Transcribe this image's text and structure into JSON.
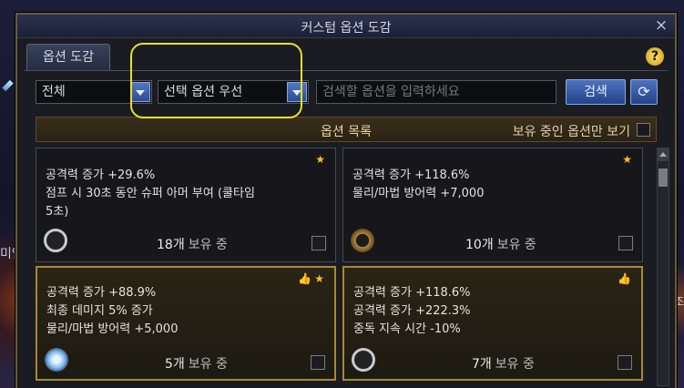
{
  "window": {
    "title": "커스텀 옵션 도감",
    "close": "×"
  },
  "tab": {
    "label": "옵션 도감"
  },
  "help": {
    "label": "?"
  },
  "filters": {
    "category": "전체",
    "order": "선택 옵션 우선",
    "search_placeholder": "검색할 옵션을 입력하세요",
    "search_button": "검색",
    "refresh_icon": "⟳"
  },
  "list": {
    "title": "옵션 목록",
    "owned_only_label": "보유 중인 옵션만 보기"
  },
  "owned_suffix": "보유 중",
  "background": {
    "left_text": "미엄",
    "right_text": "조"
  },
  "cards": [
    {
      "lines": [
        "공격력 증가 +29.6%",
        "점프 시 30초 동안 슈퍼 아머 부여 (쿨타임",
        "5초)"
      ],
      "icons": "★",
      "count": "18개",
      "highlighted": false,
      "item_icon": "ring-icon"
    },
    {
      "lines": [
        "공격력 증가 +118.6%",
        "물리/마법 방어력 +7,000"
      ],
      "icons": "★",
      "count": "10개",
      "highlighted": false,
      "item_icon": "band-icon"
    },
    {
      "lines": [
        "공격력 증가 +88.9%",
        "최종 데미지 5% 증가",
        "물리/마법 방어력 +5,000"
      ],
      "icons": "👍★",
      "count": "5개",
      "highlighted": true,
      "item_icon": "gem-icon"
    },
    {
      "lines": [
        "공격력 증가 +118.6%",
        "공격력 증가 +222.3%",
        "중독 지속 시간 -10%"
      ],
      "icons": "👍",
      "count": "7개",
      "highlighted": true,
      "item_icon": "ring-icon"
    }
  ]
}
